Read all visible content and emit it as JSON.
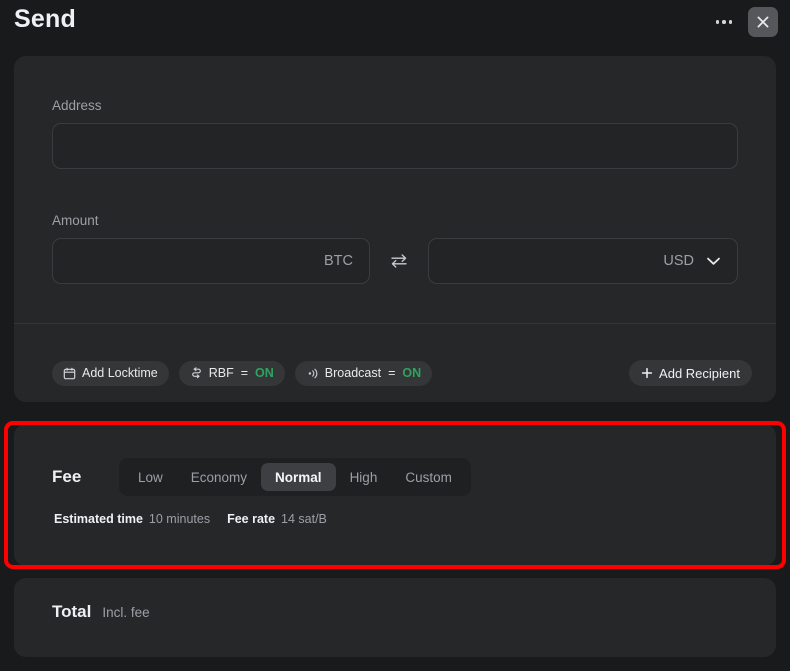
{
  "header": {
    "title": "Send",
    "more_icon": "more-horizontal-icon",
    "close_icon": "close-icon"
  },
  "form": {
    "address": {
      "label": "Address",
      "value": "",
      "placeholder": ""
    },
    "amount": {
      "label": "Amount",
      "btc": {
        "value": "",
        "unit": "BTC"
      },
      "swap_icon": "swap-horizontal-icon",
      "fiat": {
        "value": "",
        "unit": "USD",
        "chevron_icon": "chevron-down-icon"
      }
    },
    "options": [
      {
        "icon": "calendar-icon",
        "label": "Add Locktime",
        "has_state": false
      },
      {
        "icon": "rbf-swap-icon",
        "label": "RBF",
        "equals": "=",
        "state": "ON",
        "has_state": true
      },
      {
        "icon": "broadcast-icon",
        "label": "Broadcast",
        "equals": "=",
        "state": "ON",
        "has_state": true
      }
    ],
    "add_recipient": {
      "icon": "plus-icon",
      "label": "Add Recipient"
    }
  },
  "fee": {
    "label": "Fee",
    "options": [
      "Low",
      "Economy",
      "Normal",
      "High",
      "Custom"
    ],
    "selected": "Normal",
    "estimated_time_label": "Estimated time",
    "estimated_time_value": "10 minutes",
    "fee_rate_label": "Fee rate",
    "fee_rate_value": "14 sat/B"
  },
  "total": {
    "label": "Total",
    "sublabel": "Incl. fee"
  },
  "colors": {
    "page_background": "#191a1b",
    "card_background": "#262729",
    "accent_on": "#2fa360",
    "annotation_highlight": "#fe0000",
    "text_primary": "#eef1f4",
    "text_muted": "#9aa0a6"
  }
}
